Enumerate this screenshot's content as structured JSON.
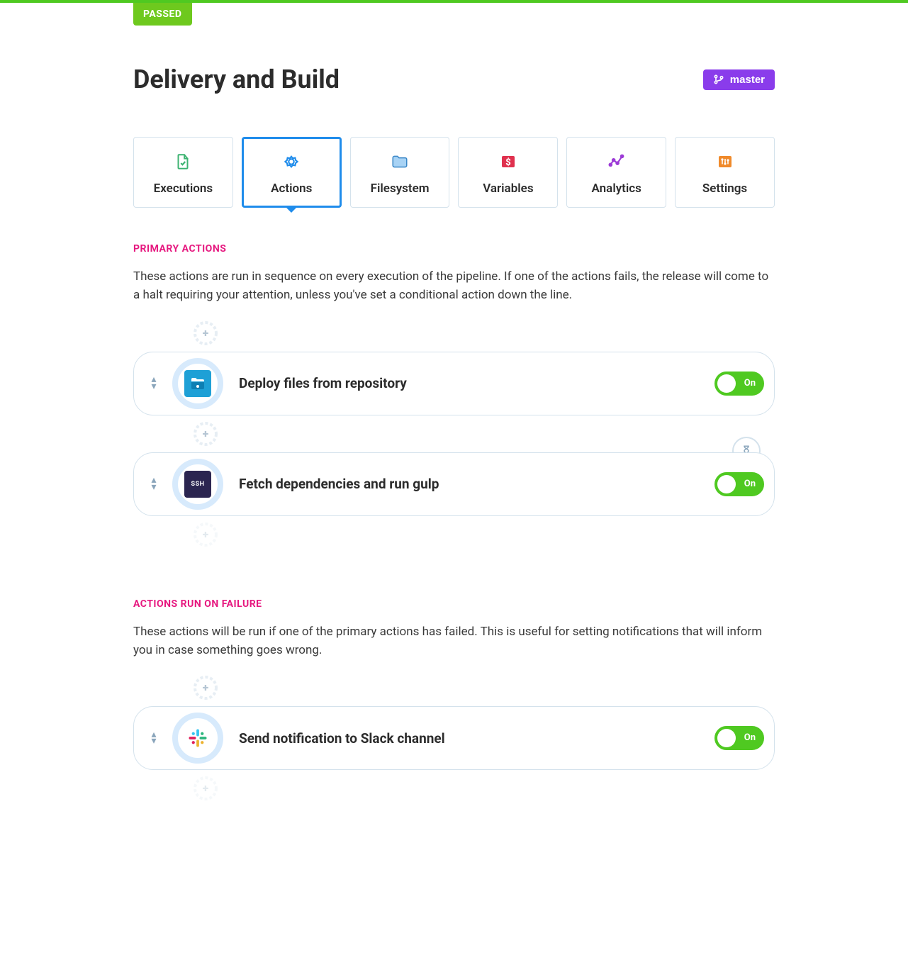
{
  "status_badge": "PASSED",
  "page_title": "Delivery and Build",
  "branch": {
    "label": "master"
  },
  "tabs": [
    {
      "id": "executions",
      "label": "Executions"
    },
    {
      "id": "actions",
      "label": "Actions",
      "active": true
    },
    {
      "id": "filesystem",
      "label": "Filesystem"
    },
    {
      "id": "variables",
      "label": "Variables"
    },
    {
      "id": "analytics",
      "label": "Analytics"
    },
    {
      "id": "settings",
      "label": "Settings"
    }
  ],
  "sections": {
    "primary": {
      "heading": "PRIMARY ACTIONS",
      "description": "These actions are run in sequence on every execution of the pipeline. If one of the actions fails, the release will come to a halt requiring your attention, unless you've set a conditional action down the line.",
      "actions": [
        {
          "label": "Deploy files from repository",
          "icon": "deploy",
          "enabled": true,
          "state_label": "On"
        },
        {
          "label": "Fetch dependencies and run gulp",
          "icon": "ssh",
          "enabled": true,
          "state_label": "On",
          "wait": true
        }
      ]
    },
    "failure": {
      "heading": "ACTIONS RUN ON FAILURE",
      "description": "These actions will be run if one of the primary actions has failed. This is useful for setting notifications that will inform you in case something goes wrong.",
      "actions": [
        {
          "label": "Send notification to Slack channel",
          "icon": "slack",
          "enabled": true,
          "state_label": "On"
        }
      ]
    }
  }
}
